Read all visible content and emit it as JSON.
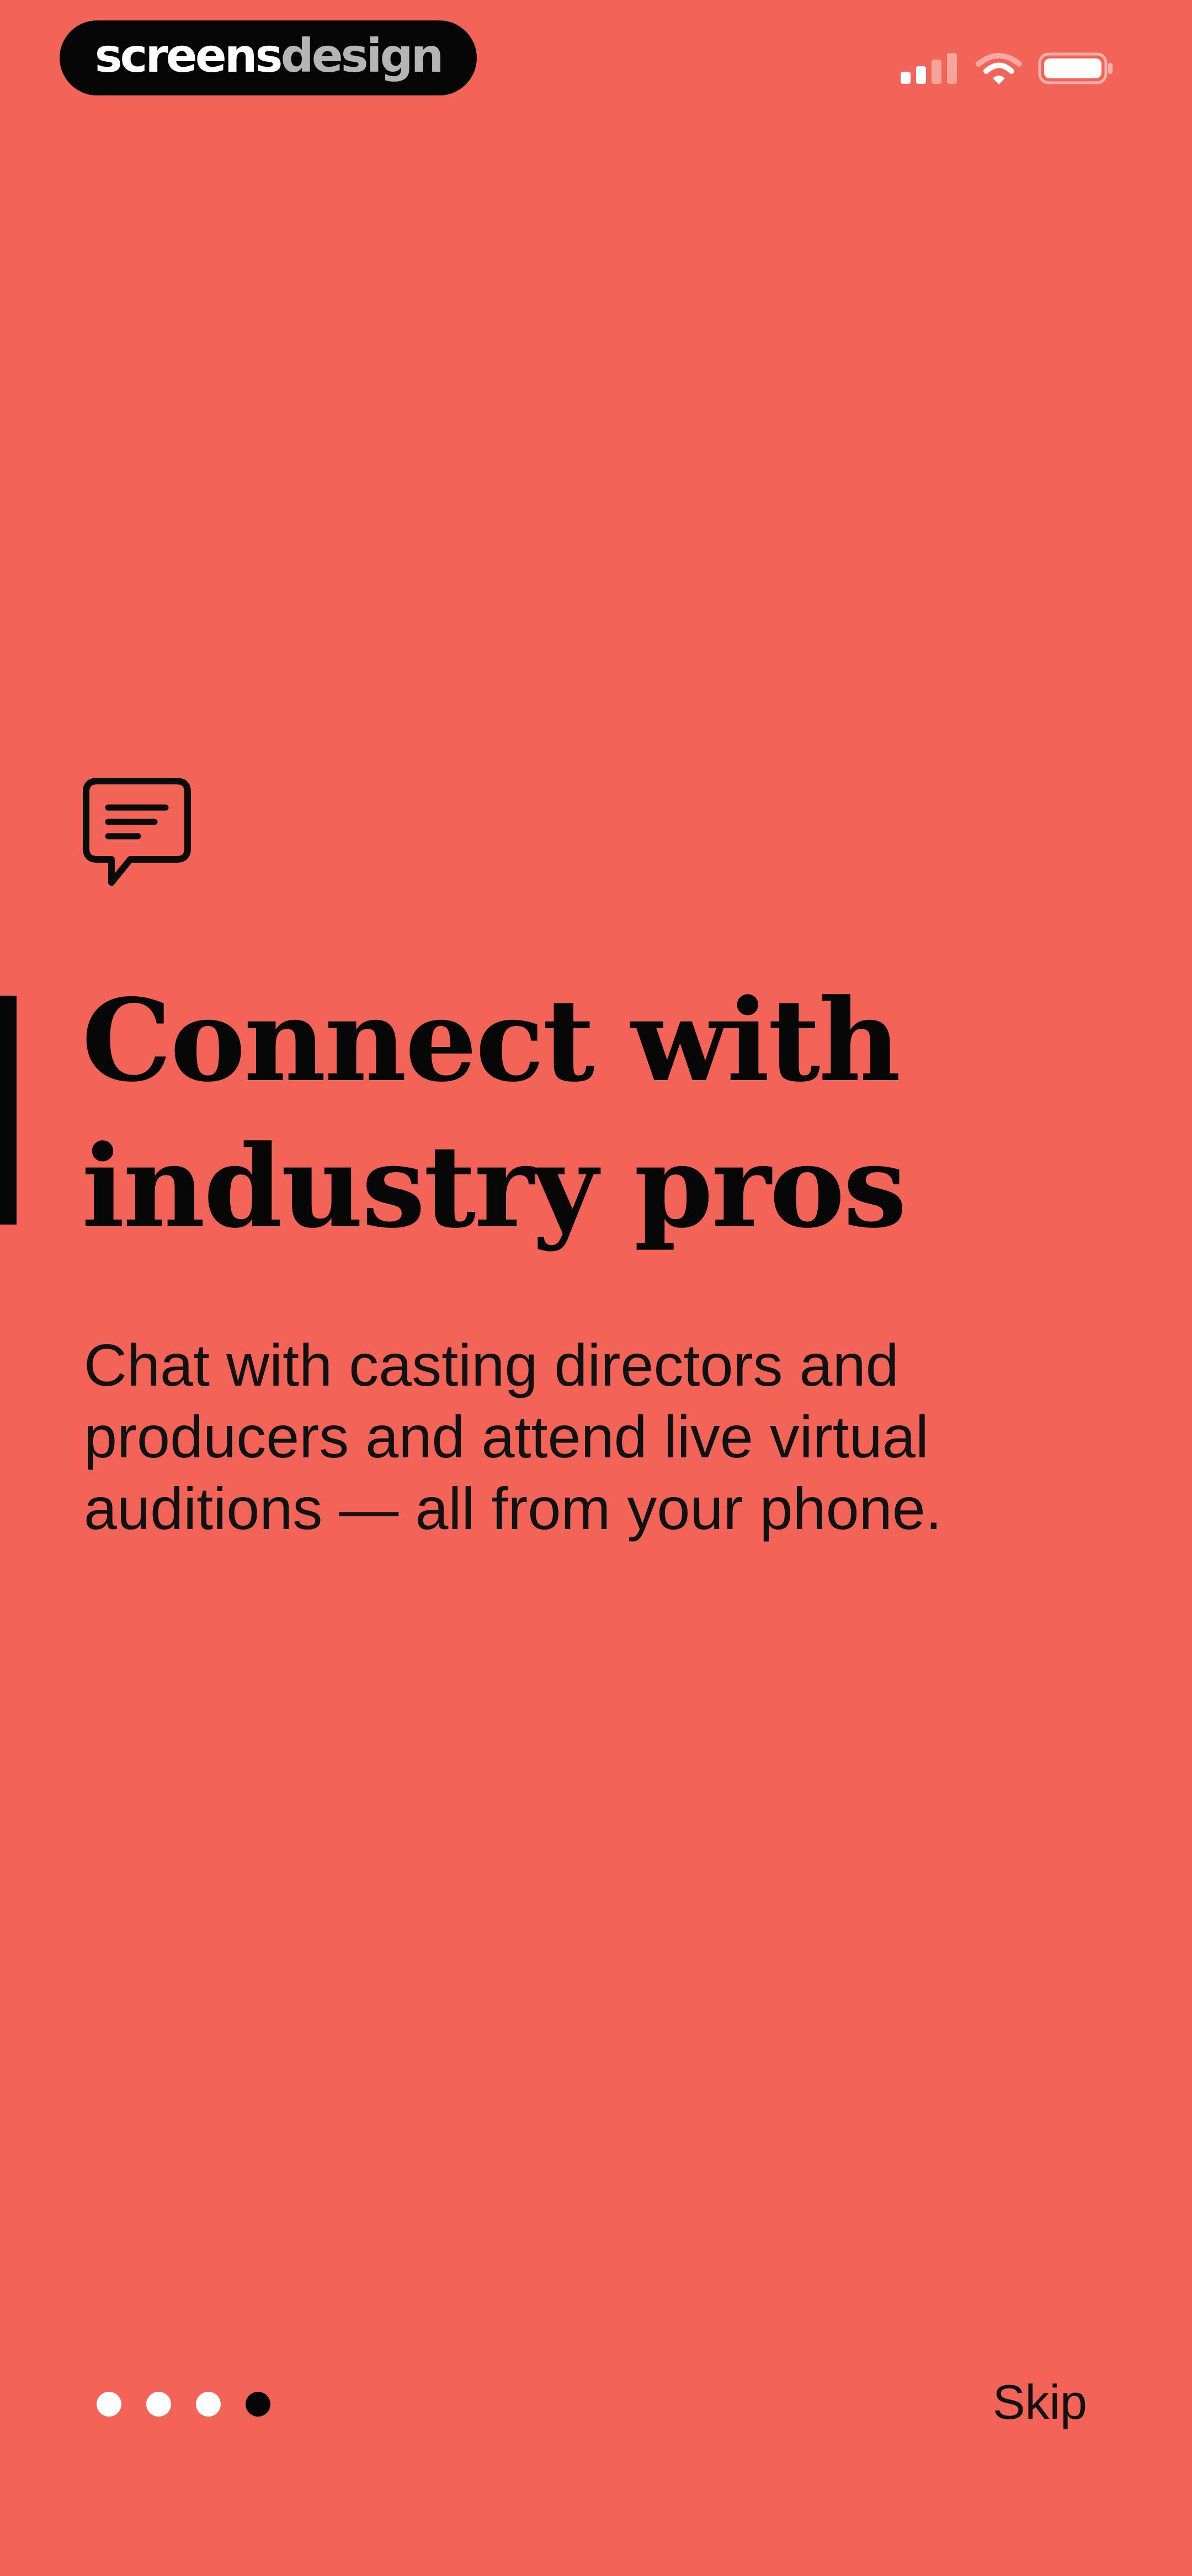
{
  "watermark": {
    "part1": "screens",
    "part2": "design"
  },
  "status_bar": {
    "icons": [
      "signal-icon",
      "wifi-icon",
      "battery-icon"
    ]
  },
  "onboarding": {
    "icon": "chat-bubble-icon",
    "title_line1": "Connect with",
    "title_line2": "industry pros",
    "body_line1": "Chat with casting directors and",
    "body_line2": "producers and attend live virtual",
    "body_line3": "auditions — all from your phone.",
    "skip_label": "Skip",
    "pager": {
      "total": 4,
      "current": 4
    }
  },
  "colors": {
    "background": "#F26457",
    "text": "#070707",
    "dot_inactive": "#FFFFFF",
    "dot_active": "#050505"
  }
}
